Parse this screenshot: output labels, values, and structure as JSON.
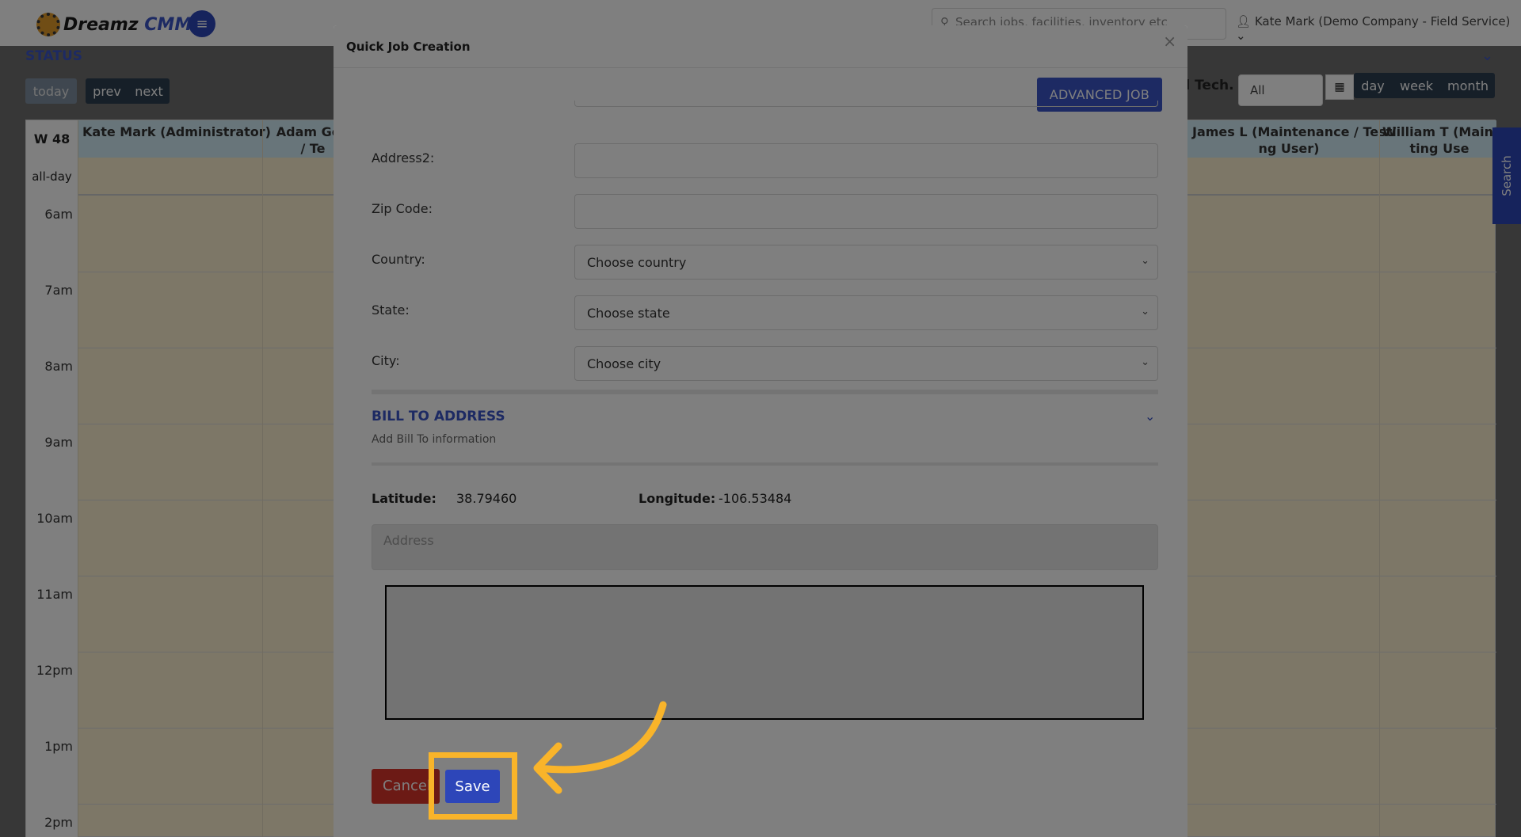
{
  "app": {
    "logo_text_main": "Dreamz",
    "logo_text_accent": "CMMS",
    "search_placeholder": "Search  jobs, facilities, inventory etc",
    "user_label": "Kate Mark (Demo Company - Field Service)"
  },
  "status": {
    "title": "STATUS",
    "today_label": "today",
    "prev_label": "prev",
    "next_label": "next",
    "tech_label": "d Tech.",
    "tech_value": "All",
    "view_day": "day",
    "view_week": "week",
    "view_month": "month"
  },
  "calendar": {
    "week_label": "W 48",
    "columns": [
      "Kate Mark (Administrator)",
      "Adam Gon\n/ Te",
      "James L (Maintenance / Testi\nng User)",
      "William T (Mainte\nting Use"
    ],
    "allday_label": "all-day",
    "times": [
      "6am",
      "7am",
      "8am",
      "9am",
      "10am",
      "11am",
      "12pm",
      "1pm",
      "2pm"
    ]
  },
  "side_tab": {
    "label": "Search"
  },
  "modal": {
    "title": "Quick Job Creation",
    "close_symbol": "×",
    "advanced_job_label": "ADVANCED JOB",
    "fields": {
      "address2_label": "Address2:",
      "zip_label": "Zip Code:",
      "country_label": "Country:",
      "country_value": "Choose country",
      "state_label": "State:",
      "state_value": "Choose state",
      "city_label": "City:",
      "city_value": "Choose city"
    },
    "bill_to": {
      "title": "BILL TO ADDRESS",
      "subtitle": "Add Bill To information"
    },
    "coords": {
      "lat_label": "Latitude:",
      "lat_value": "38.79460",
      "lon_label": "Longitude:",
      "lon_value": "-106.53484"
    },
    "address_placeholder": "Address",
    "cancel_label": "Cancel",
    "save_label": "Save"
  },
  "colors": {
    "brand": "#2d46b9",
    "accent_blue": "#3a54c6",
    "cancel_red": "#d9342b",
    "highlight": "#f9b42a"
  }
}
